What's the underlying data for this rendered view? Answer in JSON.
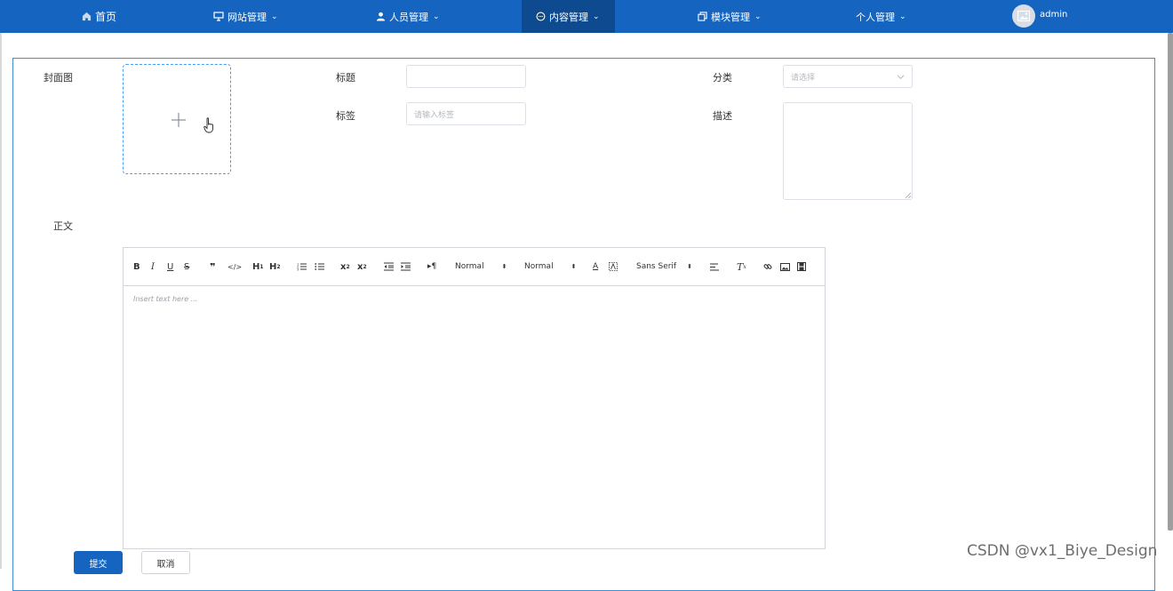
{
  "nav": {
    "items": [
      {
        "label": "首页",
        "icon": "home-icon"
      },
      {
        "label": "网站管理",
        "icon": "monitor-icon"
      },
      {
        "label": "人员管理",
        "icon": "user-icon"
      },
      {
        "label": "内容管理",
        "icon": "chat-icon",
        "active": true
      },
      {
        "label": "模块管理",
        "icon": "copy-icon"
      },
      {
        "label": "个人管理",
        "icon": ""
      }
    ],
    "user": "admin"
  },
  "form": {
    "cover_label": "封面图",
    "title_label": "标题",
    "title_value": "",
    "tag_label": "标签",
    "tag_placeholder": "请输入标签",
    "category_label": "分类",
    "category_placeholder": "请选择",
    "desc_label": "描述",
    "body_label": "正文"
  },
  "editor": {
    "font_size_1": "Normal",
    "font_size_2": "Normal",
    "font_family": "Sans Serif",
    "placeholder": "Insert text here ..."
  },
  "actions": {
    "submit": "提交",
    "cancel": "取消"
  },
  "watermark": "CSDN @vx1_Biye_Design",
  "colors": {
    "primary": "#1565c0",
    "active_nav": "#0d4a8f",
    "border_accent": "#409eff"
  }
}
